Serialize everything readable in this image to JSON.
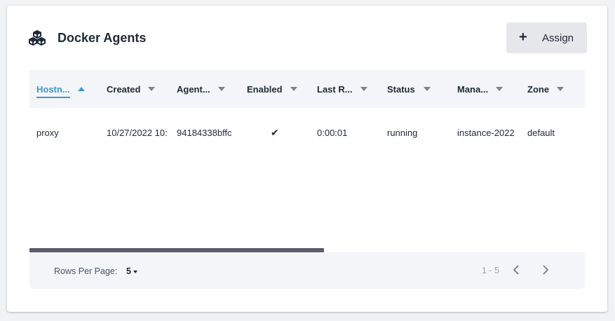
{
  "card": {
    "title": "Docker Agents",
    "assign_label": "Assign"
  },
  "table": {
    "columns": [
      {
        "label": "Hostn...",
        "sorted": "asc"
      },
      {
        "label": "Created"
      },
      {
        "label": "Agent..."
      },
      {
        "label": "Enabled"
      },
      {
        "label": "Last R..."
      },
      {
        "label": "Status"
      },
      {
        "label": "Mana..."
      },
      {
        "label": "Zone"
      }
    ],
    "rows": [
      {
        "hostname": "proxy",
        "created": "10/27/2022 10:",
        "agent": "94184338bffc",
        "enabled": "✔",
        "last_run": "0:00:01",
        "status": "running",
        "manager": "instance-2022",
        "zone": "default"
      }
    ],
    "horizontal_scroll_fraction": 0.53
  },
  "footer": {
    "rows_per_page_label": "Rows Per Page:",
    "rows_per_page_value": "5",
    "range": "1 - 5"
  },
  "icons": {
    "header": "cubes-icon",
    "assign": "plus-icon",
    "prev": "chevron-left-icon",
    "next": "chevron-right-icon"
  },
  "colors": {
    "accent": "#3d98d3",
    "scrollbar": "#5b5d6f",
    "header_bg": "#f3f5f8"
  }
}
